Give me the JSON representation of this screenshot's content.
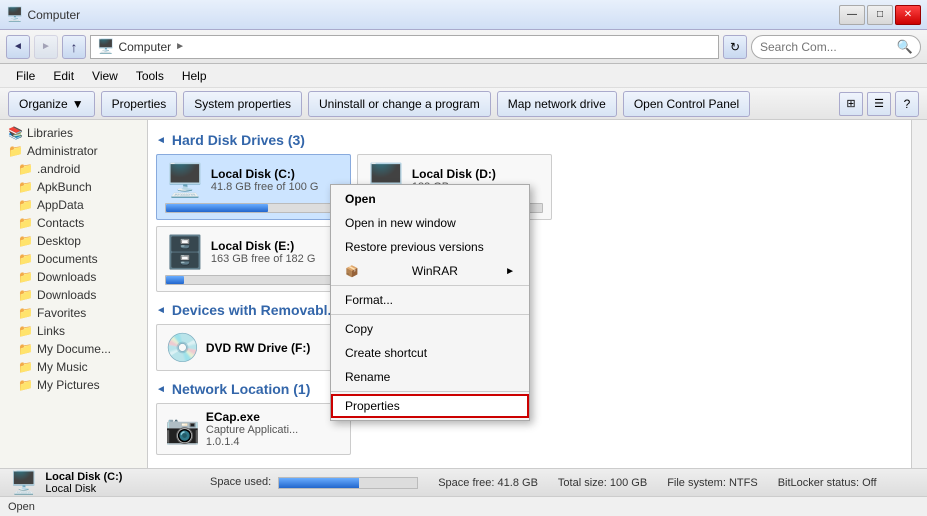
{
  "titleBar": {
    "title": "Computer",
    "minBtn": "—",
    "maxBtn": "□",
    "closeBtn": "✕"
  },
  "addressBar": {
    "backBtn": "◄",
    "forwardBtn": "►",
    "path": "Computer",
    "pathArrow": "►",
    "refreshBtn": "↻",
    "searchPlaceholder": "Search Com...",
    "searchIcon": "🔍"
  },
  "menuBar": {
    "items": [
      "File",
      "Edit",
      "View",
      "Tools",
      "Help"
    ]
  },
  "toolbar": {
    "organize": "Organize",
    "organizeArrow": "▼",
    "properties": "Properties",
    "systemProperties": "System properties",
    "uninstall": "Uninstall or change a program",
    "mapDrive": "Map network drive",
    "controlPanel": "Open Control Panel",
    "helpBtn": "?"
  },
  "sidebar": {
    "items": [
      {
        "label": "Libraries",
        "icon": "📚",
        "indent": 0
      },
      {
        "label": "Administrator",
        "icon": "📁",
        "indent": 1
      },
      {
        "label": ".android",
        "icon": "📁",
        "indent": 2
      },
      {
        "label": "ApkBunch",
        "icon": "📁",
        "indent": 2
      },
      {
        "label": "AppData",
        "icon": "📁",
        "indent": 2
      },
      {
        "label": "Contacts",
        "icon": "📁",
        "indent": 2
      },
      {
        "label": "Desktop",
        "icon": "📁",
        "indent": 2
      },
      {
        "label": "Documents",
        "icon": "📁",
        "indent": 2
      },
      {
        "label": "Downloads",
        "icon": "📁",
        "indent": 2
      },
      {
        "label": "Downloads",
        "icon": "📁",
        "indent": 2
      },
      {
        "label": "Favorites",
        "icon": "📁",
        "indent": 2
      },
      {
        "label": "Links",
        "icon": "📁",
        "indent": 2
      },
      {
        "label": "My Docume...",
        "icon": "📁",
        "indent": 2
      },
      {
        "label": "My Music",
        "icon": "📁",
        "indent": 2
      },
      {
        "label": "My Pictures",
        "icon": "📁",
        "indent": 2
      }
    ]
  },
  "content": {
    "hardDiskSection": "Hard Disk Drives (3)",
    "drives": [
      {
        "name": "Local Disk (C:)",
        "free": "41.8 GB free of 100 G",
        "fillPct": 58,
        "selected": true
      },
      {
        "name": "Local Disk (D:)",
        "free": "183 GB",
        "fillPct": 10,
        "selected": false
      },
      {
        "name": "Local Disk (E:)",
        "free": "163 GB free of 182 G",
        "fillPct": 10,
        "selected": false
      }
    ],
    "removableSection": "Devices with Removabl...",
    "dvd": {
      "name": "DVD RW Drive (F:)",
      "free": ""
    },
    "networkSection": "Network Location (1)",
    "network": {
      "name": "ECap.exe",
      "sub": "Capture Applicati...",
      "ver": "1.0.1.4"
    }
  },
  "contextMenu": {
    "items": [
      {
        "label": "Open",
        "bold": true,
        "arrow": false,
        "separator": false,
        "highlighted": false
      },
      {
        "label": "Open in new window",
        "bold": false,
        "arrow": false,
        "separator": false,
        "highlighted": false
      },
      {
        "label": "Restore previous versions",
        "bold": false,
        "arrow": false,
        "separator": false,
        "highlighted": false
      },
      {
        "label": "WinRAR",
        "bold": false,
        "arrow": true,
        "separator": false,
        "highlighted": false,
        "hasIcon": true
      },
      {
        "label": "Format...",
        "bold": false,
        "arrow": false,
        "separator": true,
        "highlighted": false
      },
      {
        "label": "Copy",
        "bold": false,
        "arrow": false,
        "separator": false,
        "highlighted": false
      },
      {
        "label": "Create shortcut",
        "bold": false,
        "arrow": false,
        "separator": false,
        "highlighted": false
      },
      {
        "label": "Rename",
        "bold": false,
        "arrow": false,
        "separator": false,
        "highlighted": false
      },
      {
        "label": "Properties",
        "bold": false,
        "arrow": false,
        "separator": false,
        "highlighted": true
      }
    ]
  },
  "statusBar": {
    "driveName": "Local Disk (C:)",
    "driveType": "Local Disk",
    "spaceUsedLabel": "Space used:",
    "spaceFreeLabel": "Space free:",
    "spaceFree": "41.8 GB",
    "totalSizeLabel": "Total size:",
    "totalSize": "100 GB",
    "fileSystemLabel": "File system:",
    "fileSystem": "NTFS",
    "bitlockerLabel": "BitLocker status:",
    "bitlocker": "Off",
    "fillPct": 58
  },
  "bottomStatus": {
    "text": "Open"
  }
}
